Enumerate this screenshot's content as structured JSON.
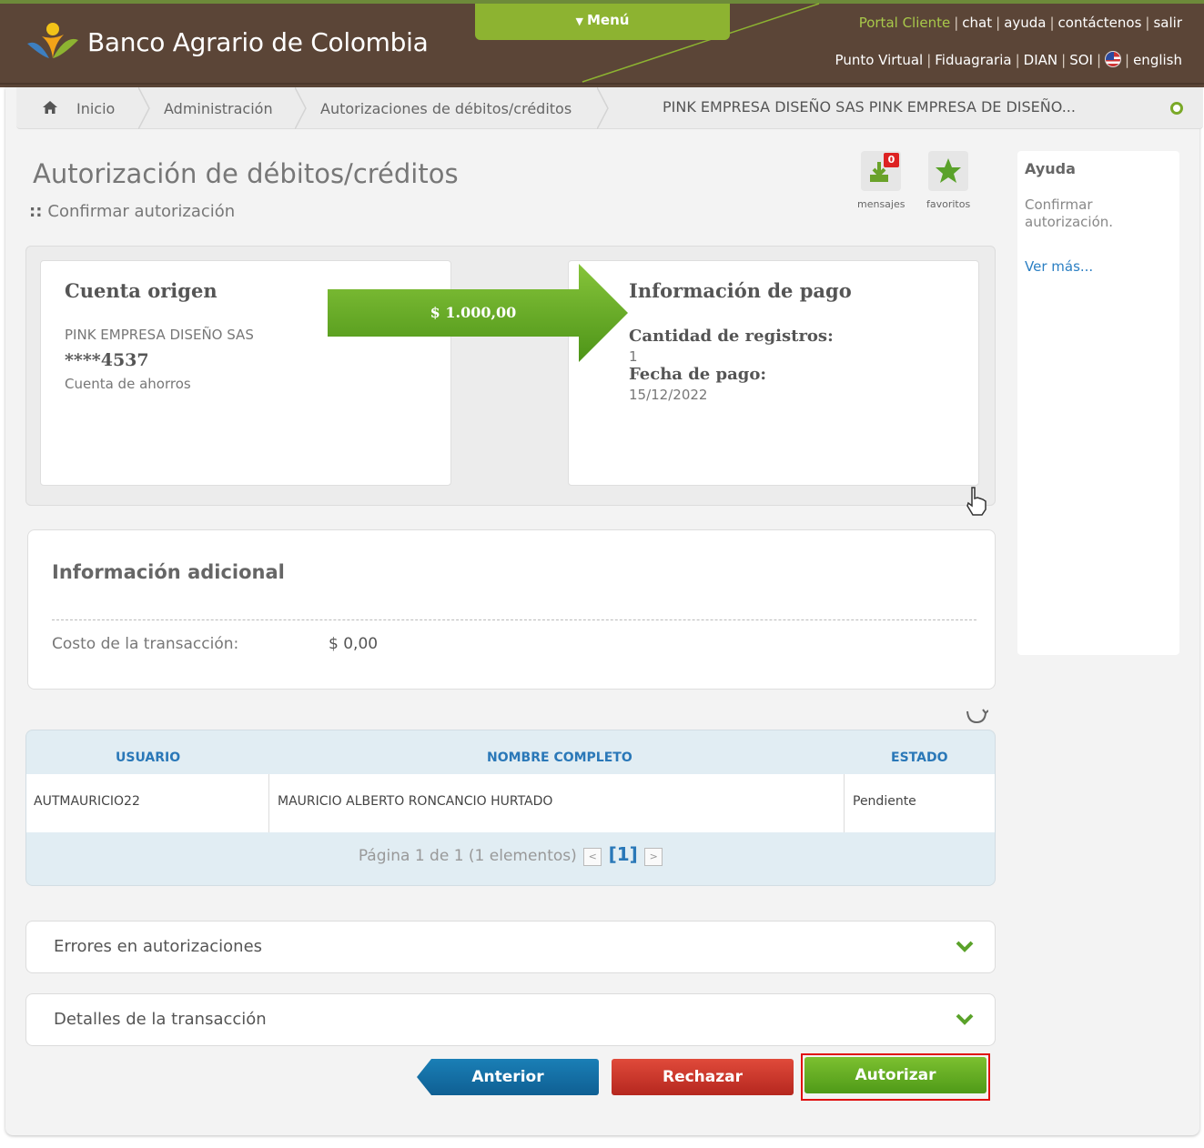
{
  "header": {
    "brand": "Banco Agrario de Colombia",
    "menu_label": "Menú",
    "top_links": [
      "Portal Cliente",
      "chat",
      "ayuda",
      "contáctenos",
      "salir"
    ],
    "sub_links": [
      "Punto Virtual",
      "Fiduagraria",
      "DIAN",
      "SOI",
      "english"
    ]
  },
  "breadcrumb": {
    "items": [
      "Inicio",
      "Administración",
      "Autorizaciones de débitos/créditos"
    ],
    "company": "PINK EMPRESA DISEÑO SAS PINK EMPRESA DE DISEÑO..."
  },
  "page": {
    "title": "Autorización de débitos/créditos",
    "subtitle": "Confirmar autorización"
  },
  "tools": {
    "messages_label": "mensajes",
    "messages_count": "0",
    "favorites_label": "favoritos"
  },
  "help": {
    "title": "Ayuda",
    "text": "Confirmar autorización.",
    "more": "Ver más..."
  },
  "origin": {
    "title": "Cuenta origen",
    "company": "PINK EMPRESA DISEÑO SAS",
    "account": "****4537",
    "type": "Cuenta de ahorros"
  },
  "amount": "$ 1.000,00",
  "payment": {
    "title": "Información de pago",
    "records_label": "Cantidad de registros:",
    "records_value": "1",
    "date_label": "Fecha de pago:",
    "date_value": "15/12/2022"
  },
  "additional": {
    "title": "Información adicional",
    "cost_label": "Costo de la transacción:",
    "cost_value": "$ 0,00"
  },
  "table": {
    "columns": [
      "USUARIO",
      "NOMBRE COMPLETO",
      "ESTADO"
    ],
    "rows": [
      [
        "AUTMAURICIO22",
        "MAURICIO ALBERTO RONCANCIO HURTADO",
        "Pendiente"
      ]
    ],
    "pager_text": "Página 1 de 1 (1 elementos)",
    "current_page": "[1]"
  },
  "accordions": [
    "Errores en autorizaciones",
    "Detalles de la transacción"
  ],
  "buttons": {
    "prev": "Anterior",
    "reject": "Rechazar",
    "authorize": "Autorizar"
  },
  "colors": {
    "header_bg": "#5b4537",
    "accent_green": "#8db331",
    "link_blue": "#2a78b8",
    "reject_red": "#c6342a",
    "prev_blue": "#15709f"
  }
}
